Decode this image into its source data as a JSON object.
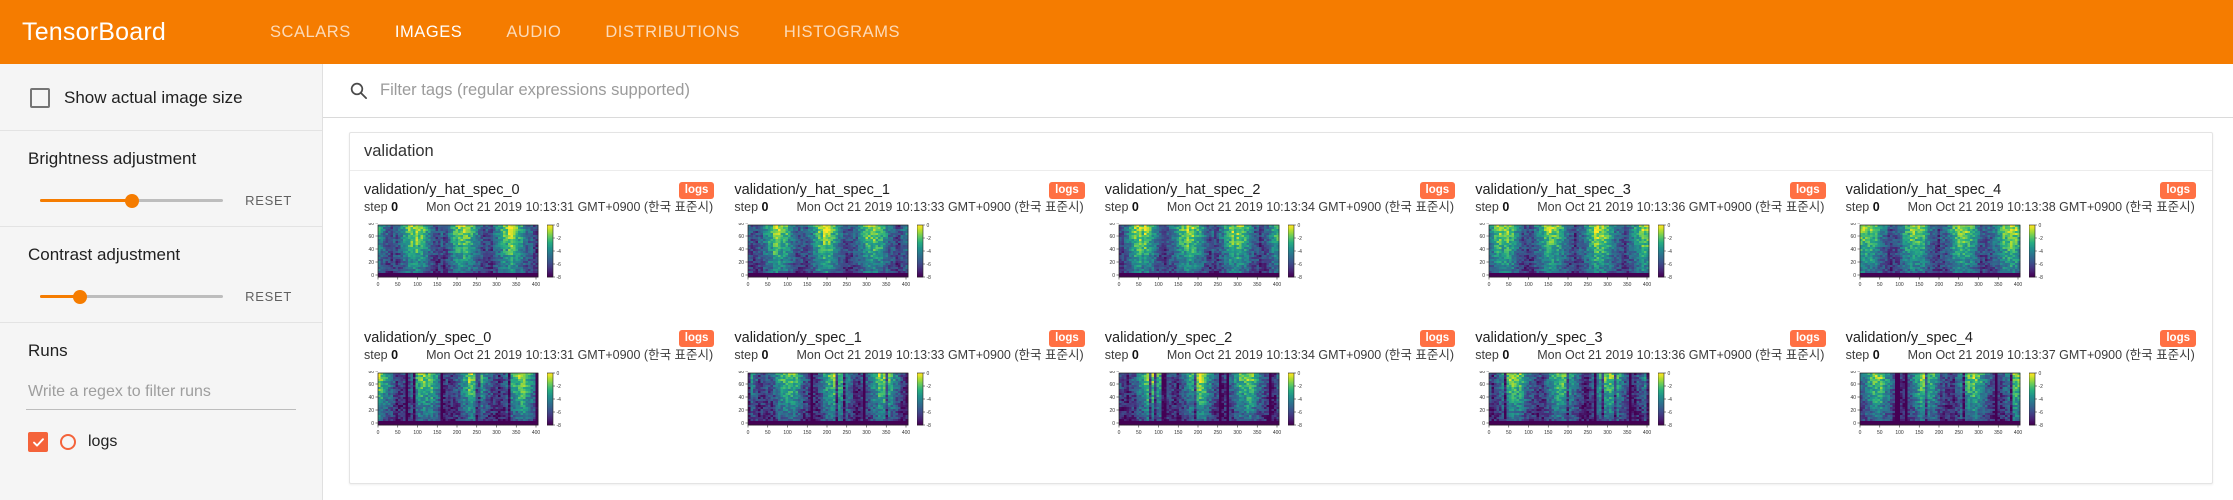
{
  "header": {
    "brand": "TensorBoard",
    "accent_color": "#f57c00",
    "tabs": [
      {
        "label": "SCALARS",
        "active": false
      },
      {
        "label": "IMAGES",
        "active": true
      },
      {
        "label": "AUDIO",
        "active": false
      },
      {
        "label": "DISTRIBUTIONS",
        "active": false
      },
      {
        "label": "HISTOGRAMS",
        "active": false
      }
    ]
  },
  "sidebar": {
    "show_actual_image_size": {
      "label": "Show actual image size",
      "checked": false
    },
    "brightness": {
      "label": "Brightness adjustment",
      "reset_label": "RESET",
      "value_pct": 50
    },
    "contrast": {
      "label": "Contrast adjustment",
      "reset_label": "RESET",
      "value_pct": 22
    },
    "runs": {
      "title": "Runs",
      "filter_placeholder": "Write a regex to filter runs",
      "filter_value": "",
      "items": [
        {
          "name": "logs",
          "checked": true,
          "color": "#f4633a"
        }
      ]
    }
  },
  "main": {
    "search": {
      "placeholder": "Filter tags (regular expressions supported)",
      "value": ""
    },
    "group": {
      "title": "validation"
    },
    "cards": [
      {
        "tag": "validation/y_hat_spec_0",
        "step_label": "step",
        "step": "0",
        "timestamp": "Mon Oct 21 2019 10:13:31 GMT+0900 (한국 표준시)",
        "run_badge": "logs",
        "kind": "y_hat"
      },
      {
        "tag": "validation/y_hat_spec_1",
        "step_label": "step",
        "step": "0",
        "timestamp": "Mon Oct 21 2019 10:13:33 GMT+0900 (한국 표준시)",
        "run_badge": "logs",
        "kind": "y_hat"
      },
      {
        "tag": "validation/y_hat_spec_2",
        "step_label": "step",
        "step": "0",
        "timestamp": "Mon Oct 21 2019 10:13:34 GMT+0900 (한국 표준시)",
        "run_badge": "logs",
        "kind": "y_hat"
      },
      {
        "tag": "validation/y_hat_spec_3",
        "step_label": "step",
        "step": "0",
        "timestamp": "Mon Oct 21 2019 10:13:36 GMT+0900 (한국 표준시)",
        "run_badge": "logs",
        "kind": "y_hat"
      },
      {
        "tag": "validation/y_hat_spec_4",
        "step_label": "step",
        "step": "0",
        "timestamp": "Mon Oct 21 2019 10:13:38 GMT+0900 (한국 표준시)",
        "run_badge": "logs",
        "kind": "y_hat"
      },
      {
        "tag": "validation/y_spec_0",
        "step_label": "step",
        "step": "0",
        "timestamp": "Mon Oct 21 2019 10:13:31 GMT+0900 (한국 표준시)",
        "run_badge": "logs",
        "kind": "y"
      },
      {
        "tag": "validation/y_spec_1",
        "step_label": "step",
        "step": "0",
        "timestamp": "Mon Oct 21 2019 10:13:33 GMT+0900 (한국 표준시)",
        "run_badge": "logs",
        "kind": "y"
      },
      {
        "tag": "validation/y_spec_2",
        "step_label": "step",
        "step": "0",
        "timestamp": "Mon Oct 21 2019 10:13:34 GMT+0900 (한국 표준시)",
        "run_badge": "logs",
        "kind": "y"
      },
      {
        "tag": "validation/y_spec_3",
        "step_label": "step",
        "step": "0",
        "timestamp": "Mon Oct 21 2019 10:13:36 GMT+0900 (한국 표준시)",
        "run_badge": "logs",
        "kind": "y"
      },
      {
        "tag": "validation/y_spec_4",
        "step_label": "step",
        "step": "0",
        "timestamp": "Mon Oct 21 2019 10:13:37 GMT+0900 (한국 표준시)",
        "run_badge": "logs",
        "kind": "y"
      }
    ],
    "spectrogram": {
      "colormap": "viridis",
      "x_ticks": [
        "0",
        "50",
        "100",
        "150",
        "200",
        "250",
        "300",
        "350",
        "400"
      ],
      "y_ticks": [
        "0",
        "20",
        "40",
        "60",
        "80"
      ],
      "colorbar_ticks": [
        "0",
        "-2",
        "-4",
        "-6",
        "-8"
      ]
    }
  }
}
